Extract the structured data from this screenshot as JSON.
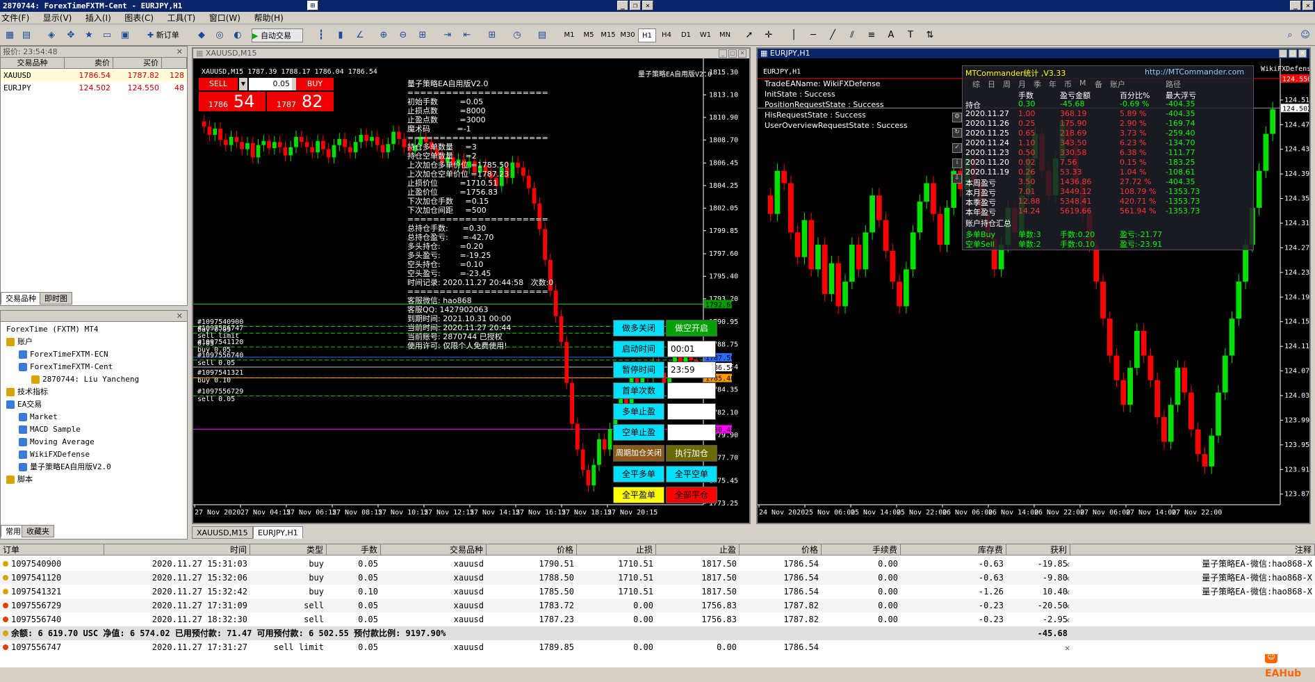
{
  "title": "2870744: ForexTimeFXTM-Cent - EURJPY,H1",
  "menu": [
    "显示(V)",
    "插入(I)",
    "图表(C)",
    "工具(T)",
    "窗口(W)",
    "帮助(H)"
  ],
  "toolbar": {
    "new_order": "新订单",
    "auto_trade": "自动交易",
    "timeframes": [
      "M1",
      "M5",
      "M15",
      "M30",
      "H1",
      "H4",
      "D1",
      "W1",
      "MN"
    ],
    "selected_tf": "H1"
  },
  "market_watch": {
    "header": "报价: 23:54:48",
    "cols": [
      "交易品种",
      "卖价",
      "买价",
      ""
    ],
    "rows": [
      {
        "symbol": "XAUUSD",
        "bid": "1786.54",
        "ask": "1787.82",
        "spread": "128"
      },
      {
        "symbol": "EURJPY",
        "bid": "124.502",
        "ask": "124.550",
        "spread": "48"
      }
    ],
    "tabs": [
      "交易品种",
      "即时图"
    ]
  },
  "navigator": {
    "title": "ForexTime (FXTM) MT4",
    "items": [
      {
        "label": "账户",
        "level": 0,
        "icon": "accounts-icon"
      },
      {
        "label": "ForexTimeFXTM-ECN",
        "level": 1,
        "icon": "server-icon"
      },
      {
        "label": "ForexTimeFXTM-Cent",
        "level": 1,
        "icon": "server-icon"
      },
      {
        "label": "2870744: Liu Yancheng",
        "level": 2,
        "icon": "user-icon"
      },
      {
        "label": "技术指标",
        "level": 0,
        "icon": "indicators-icon"
      },
      {
        "label": "EA交易",
        "level": 0,
        "icon": "expert-icon"
      },
      {
        "label": "Market",
        "level": 1,
        "icon": "market-icon"
      },
      {
        "label": "MACD Sample",
        "level": 1,
        "icon": "expert-icon"
      },
      {
        "label": "Moving Average",
        "level": 1,
        "icon": "expert-icon"
      },
      {
        "label": "WikiFXDefense",
        "level": 1,
        "icon": "expert-icon"
      },
      {
        "label": "量子策略EA自用版V2.0",
        "level": 1,
        "icon": "expert-icon"
      },
      {
        "label": "脚本",
        "level": 0,
        "icon": "scripts-icon"
      }
    ],
    "tabs": [
      "常用",
      "收藏夹"
    ]
  },
  "chart1": {
    "title": "XAUUSD,M15",
    "info": "XAUUSD,M15  1787.39 1788.17 1786.04 1786.54",
    "ea_name": "量子策略EA自用版V2.0",
    "sell_label": "SELL",
    "buy_label": "BUY",
    "lot": "0.05",
    "sell_price_small": "1786",
    "sell_price_big": "54",
    "buy_price_small": "1787",
    "buy_price_big": "82",
    "ea_lines": [
      "量子策略EA自用版V2.0",
      "======================",
      "初始手数         =0.05",
      "止损点数         =8000",
      "止盈点数         =3000",
      "魔术码           =-1",
      "======================",
      "持仓多单数量     =3",
      "持仓空单数量     =2",
      "上次加仓多单价位 =1785.50",
      "上次加仓空单价位 =1787.23",
      "止损价位         =1710.51",
      "止盈价位         =1756.83",
      "下次加仓手数     =0.15",
      "下次加仓间距     =500",
      "======================",
      "总持仓手数:      =0.30",
      "总持仓盈亏:      =-42.70",
      "多头持仓:        =0.20",
      "多头盈亏:        =-19.25",
      "空头持仓:        =0.10",
      "空头盈亏:        =-23.45",
      "时间记录: 2020.11.27 20:44:58   次数:0",
      "======================",
      "客服微信: hao868",
      "客服QQ: 1427902063",
      "到期时间: 2021.10.31 00:00",
      "当前时间: 2020.11.27 20:44",
      "当前账号: 2870744 已授权",
      "使用许可: 仅限个人免费使用!"
    ],
    "order_labels": [
      "#1097540900 buy 0.05",
      "#1097556747 sell limit 0.05",
      "#1097541120 buy 0.05",
      "#1097556740 sell 0.05",
      "#1097541321 buy 0.10",
      "#1097556729 sell 0.05"
    ],
    "buttons": {
      "close_long": "做多关闭",
      "open_short": "做空开启",
      "start_time": "启动时间",
      "start_val": "00:01",
      "pause_time": "暂停时间",
      "pause_val": "23:59",
      "first_count": "首单次数",
      "long_tp": "多单止盈",
      "short_tp": "空单止盈",
      "cycle_close": "周期加仓关闭",
      "exec_add": "执行加仓",
      "close_all_long": "全平多单",
      "close_all_short": "全平空单",
      "close_all_profit": "全平盈单",
      "close_all_loss": "全部平仓"
    },
    "price_axis": [
      "1815.30",
      "1813.10",
      "1810.90",
      "1808.70",
      "1806.45",
      "1804.25",
      "1802.05",
      "1799.85",
      "1797.60",
      "1795.40",
      "1793.20",
      "1790.95",
      "1788.75",
      "1786.54",
      "1784.35",
      "1782.10",
      "1779.90",
      "1777.70",
      "1775.45",
      "1773.25"
    ],
    "time_axis": [
      "27 Nov 2020",
      "27 Nov 04:15",
      "27 Nov 06:15",
      "27 Nov 08:15",
      "27 Nov 10:15",
      "27 Nov 12:15",
      "27 Nov 14:15",
      "27 Nov 16:15",
      "27 Nov 18:15",
      "27 Nov 20:15"
    ],
    "tag_prices": {
      "green": "1792.69",
      "blue": "1787.50",
      "white": "1786.54",
      "orange": "1785.48",
      "magenta": "1780.48"
    }
  },
  "chart2": {
    "title": "EURJPY,H1",
    "info": "EURJPY,H1",
    "status_lines": [
      "TradeEAName: WikiFXDefense",
      "InitState : Success",
      "PositionRequestState : Success",
      "HisRequestState : Success",
      "UserOverviewRequestState : Success"
    ],
    "mtc_title": "MTCommander统计 ,V3.33",
    "mtc_url": "http://MTCommander.com",
    "mtc_ea": "WikiFXDefense",
    "mtc_tabs": [
      "综",
      "日",
      "周",
      "月",
      "季",
      "年",
      "币",
      "M",
      "备",
      "账户",
      "路径"
    ],
    "mtc_header": [
      "手数",
      "盈亏金额",
      "百分比%",
      "最大浮亏"
    ],
    "mtc_rows": [
      {
        "label": "持仓",
        "lots": "0.30",
        "pl": "-45.68",
        "pct": "-0.69 %",
        "maxdd": "-404.35"
      },
      {
        "label": "2020.11.27",
        "lots": "1.00",
        "pl": "368.19",
        "pct": "5.89 %",
        "maxdd": "-404.35"
      },
      {
        "label": "2020.11.26",
        "lots": "0.25",
        "pl": "175.90",
        "pct": "2.90 %",
        "maxdd": "-169.74"
      },
      {
        "label": "2020.11.25",
        "lots": "0.65",
        "pl": "218.69",
        "pct": "3.73 %",
        "maxdd": "-259.40"
      },
      {
        "label": "2020.11.24",
        "lots": "1.10",
        "pl": "343.50",
        "pct": "6.23 %",
        "maxdd": "-134.70"
      },
      {
        "label": "2020.11.23",
        "lots": "0.50",
        "pl": "330.58",
        "pct": "6.38 %",
        "maxdd": "-111.77"
      },
      {
        "label": "2020.11.20",
        "lots": "0.02",
        "pl": "7.56",
        "pct": "0.15 %",
        "maxdd": "-183.25"
      },
      {
        "label": "2020.11.19",
        "lots": "0.26",
        "pl": "53.33",
        "pct": "1.04 %",
        "maxdd": "-108.61"
      },
      {
        "label": "本周盈亏",
        "lots": "3.50",
        "pl": "1436.86",
        "pct": "27.72 %",
        "maxdd": "-404.35"
      },
      {
        "label": "本月盈亏",
        "lots": "7.01",
        "pl": "3449.12",
        "pct": "108.79 %",
        "maxdd": "-1353.73"
      },
      {
        "label": "本季盈亏",
        "lots": "12.88",
        "pl": "5348.41",
        "pct": "420.71 %",
        "maxdd": "-1353.73"
      },
      {
        "label": "本年盈亏",
        "lots": "14.24",
        "pl": "5619.66",
        "pct": "561.94 %",
        "maxdd": "-1353.73"
      }
    ],
    "mtc_summary_title": "账户持仓汇总",
    "mtc_summary": [
      {
        "label": "多单Buy",
        "count": "单数:3",
        "lots": "手数:0.20",
        "pl": "盈亏:-21.77"
      },
      {
        "label": "空单Sell",
        "count": "单数:2",
        "lots": "手数:0.10",
        "pl": "盈亏:-23.91"
      }
    ],
    "price_axis": [
      "124.550",
      "124.515",
      "124.502",
      "124.475",
      "124.435",
      "124.395",
      "124.355",
      "124.315",
      "124.275",
      "124.235",
      "124.195",
      "124.155",
      "124.115",
      "124.075",
      "124.035",
      "123.995",
      "123.955",
      "123.915",
      "123.875"
    ],
    "time_axis": [
      "24 Nov 2020",
      "25 Nov 06:00",
      "25 Nov 14:00",
      "25 Nov 22:00",
      "26 Nov 06:00",
      "26 Nov 14:00",
      "26 Nov 22:00",
      "27 Nov 06:00",
      "27 Nov 14:00",
      "27 Nov 22:00"
    ]
  },
  "chart_tabs": [
    "XAUUSD,M15",
    "EURJPY,H1"
  ],
  "terminal": {
    "cols": [
      "订单",
      "时间",
      "类型",
      "手数",
      "交易品种",
      "价格",
      "止损",
      "止盈",
      "价格",
      "手续费",
      "库存费",
      "获利",
      "注释"
    ],
    "rows": [
      {
        "ticket": "1097540900",
        "time": "2020.11.27 15:31:03",
        "type": "buy",
        "lots": "0.05",
        "symbol": "xauusd",
        "price": "1790.51",
        "sl": "1710.51",
        "tp": "1817.50",
        "cur": "1786.54",
        "comm": "0.00",
        "swap": "-0.63",
        "profit": "-19.85",
        "comment": "量子策略EA-微信:hao868-X"
      },
      {
        "ticket": "1097541120",
        "time": "2020.11.27 15:32:06",
        "type": "buy",
        "lots": "0.05",
        "symbol": "xauusd",
        "price": "1788.50",
        "sl": "1710.51",
        "tp": "1817.50",
        "cur": "1786.54",
        "comm": "0.00",
        "swap": "-0.63",
        "profit": "-9.80",
        "comment": "量子策略EA-微信:hao868-X"
      },
      {
        "ticket": "1097541321",
        "time": "2020.11.27 15:32:42",
        "type": "buy",
        "lots": "0.10",
        "symbol": "xauusd",
        "price": "1785.50",
        "sl": "1710.51",
        "tp": "1817.50",
        "cur": "1786.54",
        "comm": "0.00",
        "swap": "-1.26",
        "profit": "10.40",
        "comment": "量子策略EA-微信:hao868-X"
      },
      {
        "ticket": "1097556729",
        "time": "2020.11.27 17:31:09",
        "type": "sell",
        "lots": "0.05",
        "symbol": "xauusd",
        "price": "1783.72",
        "sl": "0.00",
        "tp": "1756.83",
        "cur": "1787.82",
        "comm": "0.00",
        "swap": "-0.23",
        "profit": "-20.50",
        "comment": ""
      },
      {
        "ticket": "1097556740",
        "time": "2020.11.27 18:32:30",
        "type": "sell",
        "lots": "0.05",
        "symbol": "xauusd",
        "price": "1787.23",
        "sl": "0.00",
        "tp": "1756.83",
        "cur": "1787.82",
        "comm": "0.00",
        "swap": "-0.23",
        "profit": "-2.95",
        "comment": ""
      }
    ],
    "summary": "余额: 6 619.70 USC  净值: 6 574.02  已用预付款: 71.47  可用预付款: 6 502.55  预付款比例: 9197.90%",
    "summary_profit": "-45.68",
    "pending": {
      "ticket": "1097556747",
      "time": "2020.11.27 17:31:27",
      "type": "sell limit",
      "lots": "0.05",
      "symbol": "xauusd",
      "price": "1789.85",
      "sl": "0.00",
      "tp": "0.00",
      "cur": "1786.54"
    }
  },
  "watermark": "EAHub",
  "colors": {
    "bull": "#00e000",
    "bear": "#ff0000",
    "title_blue": "#0a246a"
  }
}
